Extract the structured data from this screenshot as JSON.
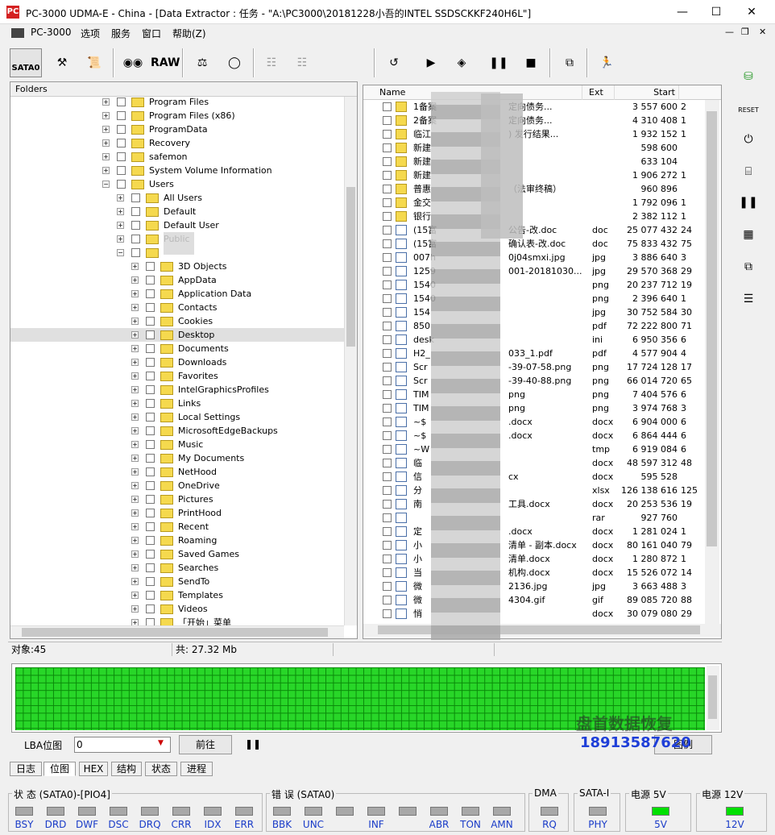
{
  "window": {
    "title": "PC-3000 UDMA-E - China - [Data Extractor : 任务 - \"A:\\PC3000\\20181228小吾的INTEL SSDSCKKF240H6L\"]",
    "app_icon_text": "PC"
  },
  "menu": [
    "PC-3000",
    "选项",
    "服务",
    "窗口",
    "帮助(Z)"
  ],
  "toolbar": {
    "port_label": "SATA0",
    "raw_label": "RAW"
  },
  "folders": {
    "header": "Folders",
    "items": [
      {
        "label": "Program Files",
        "level": 0
      },
      {
        "label": "Program Files (x86)",
        "level": 0
      },
      {
        "label": "ProgramData",
        "level": 0
      },
      {
        "label": "Recovery",
        "level": 0
      },
      {
        "label": "safemon",
        "level": 0
      },
      {
        "label": "System Volume Information",
        "level": 0
      },
      {
        "label": "Users",
        "level": 0,
        "expanded": true
      },
      {
        "label": "All Users",
        "level": 1
      },
      {
        "label": "Default",
        "level": 1
      },
      {
        "label": "Default User",
        "level": 1
      },
      {
        "label": "Public",
        "level": 1
      },
      {
        "label": "",
        "level": 1,
        "expanded": true
      },
      {
        "label": "3D Objects",
        "level": 2
      },
      {
        "label": "AppData",
        "level": 2
      },
      {
        "label": "Application Data",
        "level": 2
      },
      {
        "label": "Contacts",
        "level": 2
      },
      {
        "label": "Cookies",
        "level": 2
      },
      {
        "label": "Desktop",
        "level": 2,
        "selected": true
      },
      {
        "label": "Documents",
        "level": 2
      },
      {
        "label": "Downloads",
        "level": 2
      },
      {
        "label": "Favorites",
        "level": 2
      },
      {
        "label": "IntelGraphicsProfiles",
        "level": 2
      },
      {
        "label": "Links",
        "level": 2
      },
      {
        "label": "Local Settings",
        "level": 2
      },
      {
        "label": "MicrosoftEdgeBackups",
        "level": 2
      },
      {
        "label": "Music",
        "level": 2
      },
      {
        "label": "My Documents",
        "level": 2
      },
      {
        "label": "NetHood",
        "level": 2
      },
      {
        "label": "OneDrive",
        "level": 2
      },
      {
        "label": "Pictures",
        "level": 2
      },
      {
        "label": "PrintHood",
        "level": 2
      },
      {
        "label": "Recent",
        "level": 2
      },
      {
        "label": "Roaming",
        "level": 2
      },
      {
        "label": "Saved Games",
        "level": 2
      },
      {
        "label": "Searches",
        "level": 2
      },
      {
        "label": "SendTo",
        "level": 2
      },
      {
        "label": "Templates",
        "level": 2
      },
      {
        "label": "Videos",
        "level": 2
      },
      {
        "label": "「开始」菜单",
        "level": 2
      }
    ]
  },
  "files": {
    "columns": {
      "name": "Name",
      "ext": "Ext",
      "start": "Start"
    },
    "rows": [
      {
        "type": "folder",
        "name": "1备案",
        "name2": "定向债务...",
        "ext": "",
        "start": "3 557 600",
        "size": "2"
      },
      {
        "type": "folder",
        "name": "2备案",
        "name2": "定向债务...",
        "ext": "",
        "start": "4 310 408",
        "size": "1"
      },
      {
        "type": "folder",
        "name": "临江",
        "name2": ") 发行结果...",
        "ext": "",
        "start": "1 932 152",
        "size": "1"
      },
      {
        "type": "folder",
        "name": "新建",
        "name2": "",
        "ext": "",
        "start": "598 600",
        "size": ""
      },
      {
        "type": "folder",
        "name": "新建",
        "name2": "",
        "ext": "",
        "start": "633 104",
        "size": ""
      },
      {
        "type": "folder",
        "name": "新建",
        "name2": "",
        "ext": "",
        "start": "1 906 272",
        "size": "1"
      },
      {
        "type": "folder",
        "name": "普惠",
        "name2": "（法审终稿）",
        "ext": "",
        "start": "960 896",
        "size": ""
      },
      {
        "type": "folder",
        "name": "金交",
        "name2": "",
        "ext": "",
        "start": "1 792 096",
        "size": "1"
      },
      {
        "type": "folder",
        "name": "银行",
        "name2": "",
        "ext": "",
        "start": "2 382 112",
        "size": "1"
      },
      {
        "type": "file",
        "name": "(15富",
        "name2": "公告-改.doc",
        "ext": "doc",
        "start": "25 077 432",
        "size": "24"
      },
      {
        "type": "file",
        "name": "(15富",
        "name2": "确认表-改.doc",
        "ext": "doc",
        "start": "75 833 432",
        "size": "75"
      },
      {
        "type": "file",
        "name": "007h",
        "name2": "0j04smxi.jpg",
        "ext": "jpg",
        "start": "3 886 640",
        "size": "3"
      },
      {
        "type": "file",
        "name": "1259",
        "name2": "001-20181030...",
        "ext": "jpg",
        "start": "29 570 368",
        "size": "29"
      },
      {
        "type": "file",
        "name": "1540",
        "name2": "",
        "ext": "png",
        "start": "20 237 712",
        "size": "19"
      },
      {
        "type": "file",
        "name": "1540",
        "name2": "",
        "ext": "png",
        "start": "2 396 640",
        "size": "1"
      },
      {
        "type": "file",
        "name": "154",
        "name2": "",
        "ext": "jpg",
        "start": "30 752 584",
        "size": "30"
      },
      {
        "type": "file",
        "name": "850",
        "name2": "",
        "ext": "pdf",
        "start": "72 222 800",
        "size": "71"
      },
      {
        "type": "file",
        "name": "desk",
        "name2": "",
        "ext": "ini",
        "start": "6 950 356",
        "size": "6"
      },
      {
        "type": "file",
        "name": "H2_",
        "name2": "033_1.pdf",
        "ext": "pdf",
        "start": "4 577 904",
        "size": "4"
      },
      {
        "type": "file",
        "name": "Scr",
        "name2": "-39-07-58.png",
        "ext": "png",
        "start": "17 724 128",
        "size": "17"
      },
      {
        "type": "file",
        "name": "Scr",
        "name2": "-39-40-88.png",
        "ext": "png",
        "start": "66 014 720",
        "size": "65"
      },
      {
        "type": "file",
        "name": "TIM",
        "name2": "png",
        "ext": "png",
        "start": "7 404 576",
        "size": "6"
      },
      {
        "type": "file",
        "name": "TIM",
        "name2": "png",
        "ext": "png",
        "start": "3 974 768",
        "size": "3"
      },
      {
        "type": "file",
        "name": "~$",
        "name2": ".docx",
        "ext": "docx",
        "start": "6 904 000",
        "size": "6"
      },
      {
        "type": "file",
        "name": "~$",
        "name2": ".docx",
        "ext": "docx",
        "start": "6 864 444",
        "size": "6"
      },
      {
        "type": "file",
        "name": "~W",
        "name2": "",
        "ext": "tmp",
        "start": "6 919 084",
        "size": "6"
      },
      {
        "type": "file",
        "name": "临",
        "name2": "",
        "ext": "docx",
        "start": "48 597 312",
        "size": "48"
      },
      {
        "type": "file",
        "name": "信",
        "name2": "cx",
        "ext": "docx",
        "start": "595 528",
        "size": ""
      },
      {
        "type": "file",
        "name": "分",
        "name2": "",
        "ext": "xlsx",
        "start": "126 138 616",
        "size": "125"
      },
      {
        "type": "file",
        "name": "南",
        "name2": "工具.docx",
        "ext": "docx",
        "start": "20 253 536",
        "size": "19"
      },
      {
        "type": "file",
        "name": "",
        "name2": "",
        "ext": "rar",
        "start": "927 760",
        "size": ""
      },
      {
        "type": "file",
        "name": "定",
        "name2": ".docx",
        "ext": "docx",
        "start": "1 281 024",
        "size": "1"
      },
      {
        "type": "file",
        "name": "小",
        "name2": "清单 - 副本.docx",
        "ext": "docx",
        "start": "80 161 040",
        "size": "79"
      },
      {
        "type": "file",
        "name": "小",
        "name2": "清单.docx",
        "ext": "docx",
        "start": "1 280 872",
        "size": "1"
      },
      {
        "type": "file",
        "name": "当",
        "name2": "机构.docx",
        "ext": "docx",
        "start": "15 526 072",
        "size": "14"
      },
      {
        "type": "file",
        "name": "微",
        "name2": "2136.jpg",
        "ext": "jpg",
        "start": "3 663 488",
        "size": "3"
      },
      {
        "type": "file",
        "name": "微",
        "name2": "4304.gif",
        "ext": "gif",
        "start": "89 085 720",
        "size": "88"
      },
      {
        "type": "file",
        "name": "悄",
        "name2": "",
        "ext": "docx",
        "start": "30 079 080",
        "size": "29"
      }
    ]
  },
  "status": {
    "objects": "对象:45",
    "total": "共: 27.32 Mb"
  },
  "lba": {
    "label": "LBA位图",
    "value": "0",
    "goto": "前往",
    "map_btn": "图例"
  },
  "tabs": [
    "日志",
    "位图",
    "HEX",
    "结构",
    "状态",
    "进程"
  ],
  "registers": {
    "status_title": "状 态 (SATA0)-[PIO4]",
    "status_leds": [
      "BSY",
      "DRD",
      "DWF",
      "DSC",
      "DRQ",
      "CRR",
      "IDX",
      "ERR"
    ],
    "error_title": "错 误 (SATA0)",
    "error_leds": [
      "BBK",
      "UNC",
      "",
      "INF",
      "",
      "ABR",
      "TON",
      "AMN"
    ],
    "dma_title": "DMA",
    "dma_leds": [
      "RQ"
    ],
    "sata_title": "SATA-I",
    "sata_leds": [
      "PHY"
    ],
    "p5_title": "电源 5V",
    "p5_leds": [
      "5V"
    ],
    "p12_title": "电源 12V",
    "p12_leds": [
      "12V"
    ]
  },
  "watermark": {
    "line1": "盘首数据恢复",
    "line2": "18913587620"
  }
}
